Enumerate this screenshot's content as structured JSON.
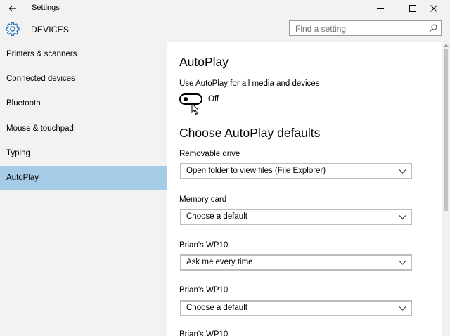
{
  "window": {
    "title": "Settings",
    "minimize_symbol": "—",
    "maximize_symbol": "☐",
    "close_symbol": "✕"
  },
  "header": {
    "section_title": "DEVICES",
    "icon": "gear-icon",
    "search_placeholder": "Find a setting"
  },
  "sidebar": {
    "items": [
      {
        "label": "Printers & scanners",
        "active": false
      },
      {
        "label": "Connected devices",
        "active": false
      },
      {
        "label": "Bluetooth",
        "active": false
      },
      {
        "label": "Mouse & touchpad",
        "active": false
      },
      {
        "label": "Typing",
        "active": false
      },
      {
        "label": "AutoPlay",
        "active": true
      }
    ],
    "active_color": "#a6cbe6"
  },
  "main": {
    "title": "AutoPlay",
    "toggle": {
      "label": "Use AutoPlay for all media and devices",
      "state": "Off",
      "on": false
    },
    "defaults_title": "Choose AutoPlay defaults",
    "fields": [
      {
        "label": "Removable drive",
        "value": "Open folder to view files (File Explorer)"
      },
      {
        "label": "Memory card",
        "value": "Choose a default"
      },
      {
        "label": "Brian's WP10",
        "value": "Ask me every time"
      },
      {
        "label": "Brian's WP10",
        "value": "Choose a default"
      },
      {
        "label": "Brian's WP10",
        "value": ""
      }
    ]
  }
}
